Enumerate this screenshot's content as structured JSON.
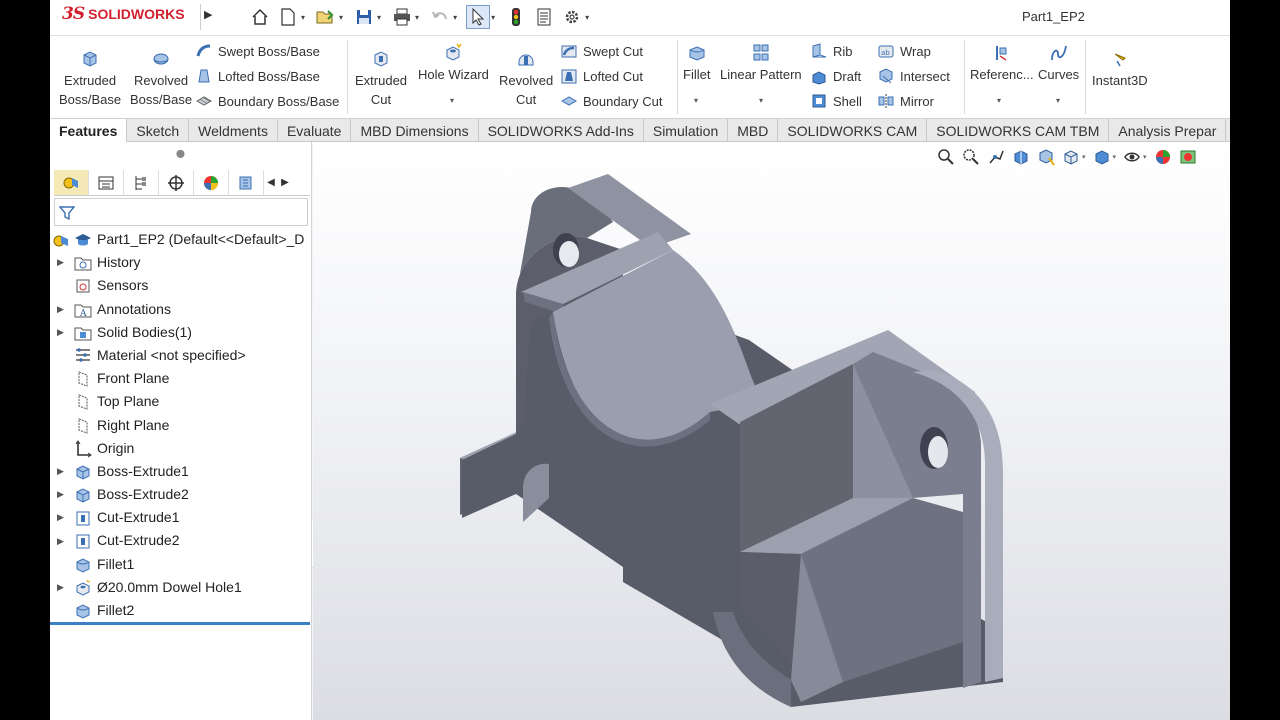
{
  "app": {
    "logo_ds": "3S",
    "logo_text": "SOLIDWORKS",
    "document_title": "Part1_EP2"
  },
  "quick_access": [
    "home-icon",
    "new-document-icon",
    "open-icon",
    "save-icon",
    "print-icon",
    "undo-icon",
    "select-icon",
    "rebuild-icon",
    "file-properties-icon",
    "options-icon"
  ],
  "ribbon": {
    "extruded_boss": "Extruded\nBoss/Base",
    "revolved_boss": "Revolved\nBoss/Base",
    "swept_boss": "Swept Boss/Base",
    "lofted_boss": "Lofted Boss/Base",
    "boundary_boss": "Boundary Boss/Base",
    "extruded_cut": "Extruded\nCut",
    "hole_wizard": "Hole Wizard",
    "revolved_cut": "Revolved\nCut",
    "swept_cut": "Swept Cut",
    "lofted_cut": "Lofted Cut",
    "boundary_cut": "Boundary Cut",
    "fillet": "Fillet",
    "linear_pattern": "Linear Pattern",
    "rib": "Rib",
    "draft": "Draft",
    "shell": "Shell",
    "wrap": "Wrap",
    "intersect": "Intersect",
    "mirror": "Mirror",
    "reference": "Referenc...",
    "curves": "Curves",
    "instant3d": "Instant3D"
  },
  "tabs": [
    {
      "label": "Features",
      "active": true
    },
    {
      "label": "Sketch"
    },
    {
      "label": "Weldments"
    },
    {
      "label": "Evaluate"
    },
    {
      "label": "MBD Dimensions"
    },
    {
      "label": "SOLIDWORKS Add-Ins"
    },
    {
      "label": "Simulation"
    },
    {
      "label": "MBD"
    },
    {
      "label": "SOLIDWORKS CAM"
    },
    {
      "label": "SOLIDWORKS CAM TBM"
    },
    {
      "label": "Analysis Prepar"
    }
  ],
  "tree": {
    "root": "Part1_EP2  (Default<<Default>_D",
    "items": [
      {
        "label": "History",
        "icon": "history-folder-icon",
        "expandable": true
      },
      {
        "label": "Sensors",
        "icon": "sensors-icon",
        "expandable": false
      },
      {
        "label": "Annotations",
        "icon": "annotations-icon",
        "expandable": true
      },
      {
        "label": "Solid Bodies(1)",
        "icon": "solid-bodies-folder-icon",
        "expandable": true
      },
      {
        "label": "Material <not specified>",
        "icon": "material-icon",
        "expandable": false
      },
      {
        "label": "Front Plane",
        "icon": "plane-icon",
        "expandable": false
      },
      {
        "label": "Top Plane",
        "icon": "plane-icon",
        "expandable": false
      },
      {
        "label": "Right Plane",
        "icon": "plane-icon",
        "expandable": false
      },
      {
        "label": "Origin",
        "icon": "origin-icon",
        "expandable": false
      },
      {
        "label": "Boss-Extrude1",
        "icon": "boss-extrude-icon",
        "expandable": true
      },
      {
        "label": "Boss-Extrude2",
        "icon": "boss-extrude-icon",
        "expandable": true
      },
      {
        "label": "Cut-Extrude1",
        "icon": "cut-extrude-icon",
        "expandable": true
      },
      {
        "label": "Cut-Extrude2",
        "icon": "cut-extrude-icon",
        "expandable": true
      },
      {
        "label": "Fillet1",
        "icon": "fillet-icon",
        "expandable": false
      },
      {
        "label": "Ø20.0mm Dowel Hole1",
        "icon": "hole-wizard-icon",
        "expandable": true
      },
      {
        "label": "Fillet2",
        "icon": "fillet-icon",
        "expandable": false
      }
    ]
  },
  "colors": {
    "accent": "#3d7fc7",
    "brand": "#d2202f",
    "model_dark": "#575a66",
    "model_light": "#9ea1b1"
  }
}
